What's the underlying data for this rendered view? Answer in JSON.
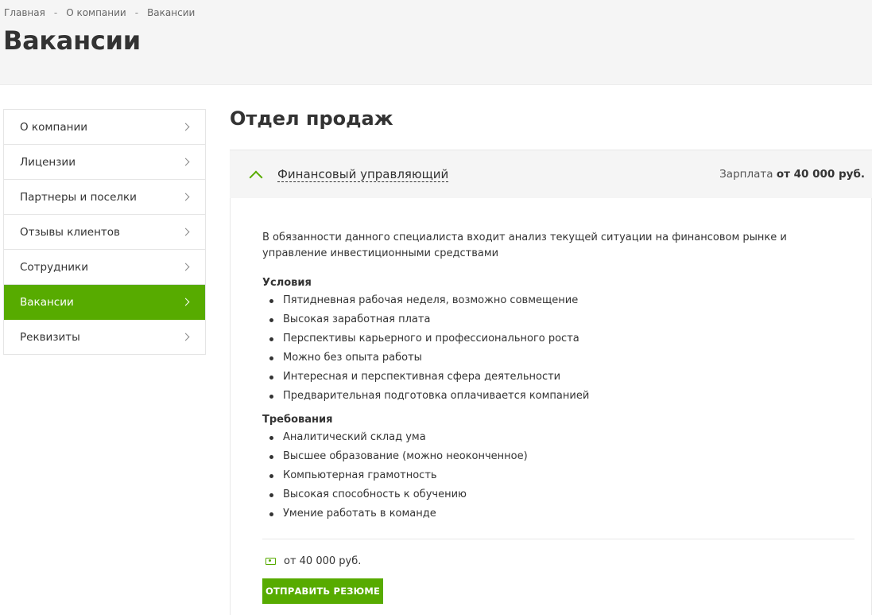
{
  "breadcrumb": {
    "items": [
      "Главная",
      "О компании",
      "Вакансии"
    ],
    "separator": "-"
  },
  "page": {
    "title": "Вакансии"
  },
  "sidebar": {
    "items": [
      {
        "label": "О компании",
        "active": false
      },
      {
        "label": "Лицензии",
        "active": false
      },
      {
        "label": "Партнеры и поселки",
        "active": false
      },
      {
        "label": "Отзывы клиентов",
        "active": false
      },
      {
        "label": "Сотрудники",
        "active": false
      },
      {
        "label": "Вакансии",
        "active": true
      },
      {
        "label": "Реквизиты",
        "active": false
      }
    ]
  },
  "section": {
    "title": "Отдел продаж"
  },
  "vacancy": {
    "name": "Финансовый управляющий",
    "salary_prefix": "Зарплата",
    "salary_value": "от 40 000 руб.",
    "description": "В обязанности данного специалиста входит анализ текущей ситуации на финансовом рынке и управление инвестиционными средствами",
    "conditions_title": "Условия",
    "conditions": [
      "Пятидневная рабочая неделя, возможно совмещение",
      "Высокая заработная плата",
      "Перспективы карьерного и профессионального роста",
      "Можно без опыта работы",
      "Интересная и перспективная сфера деятельности",
      "Предварительная подготовка оплачивается компанией"
    ],
    "requirements_title": "Требования",
    "requirements": [
      "Аналитический склад ума",
      "Высшее образование (можно неоконченное)",
      "Компьютерная грамотность",
      "Высокая способность к обучению",
      "Умение работать в команде"
    ],
    "footer_salary": "от 40 000 руб.",
    "send_button": "Отправить резюме"
  },
  "colors": {
    "accent": "#57ab00",
    "band": "#f5f5f5",
    "text": "#333333"
  },
  "icons": {
    "chevron": "chevron-right-icon",
    "toggle": "chevron-up-icon",
    "money": "money-icon"
  }
}
